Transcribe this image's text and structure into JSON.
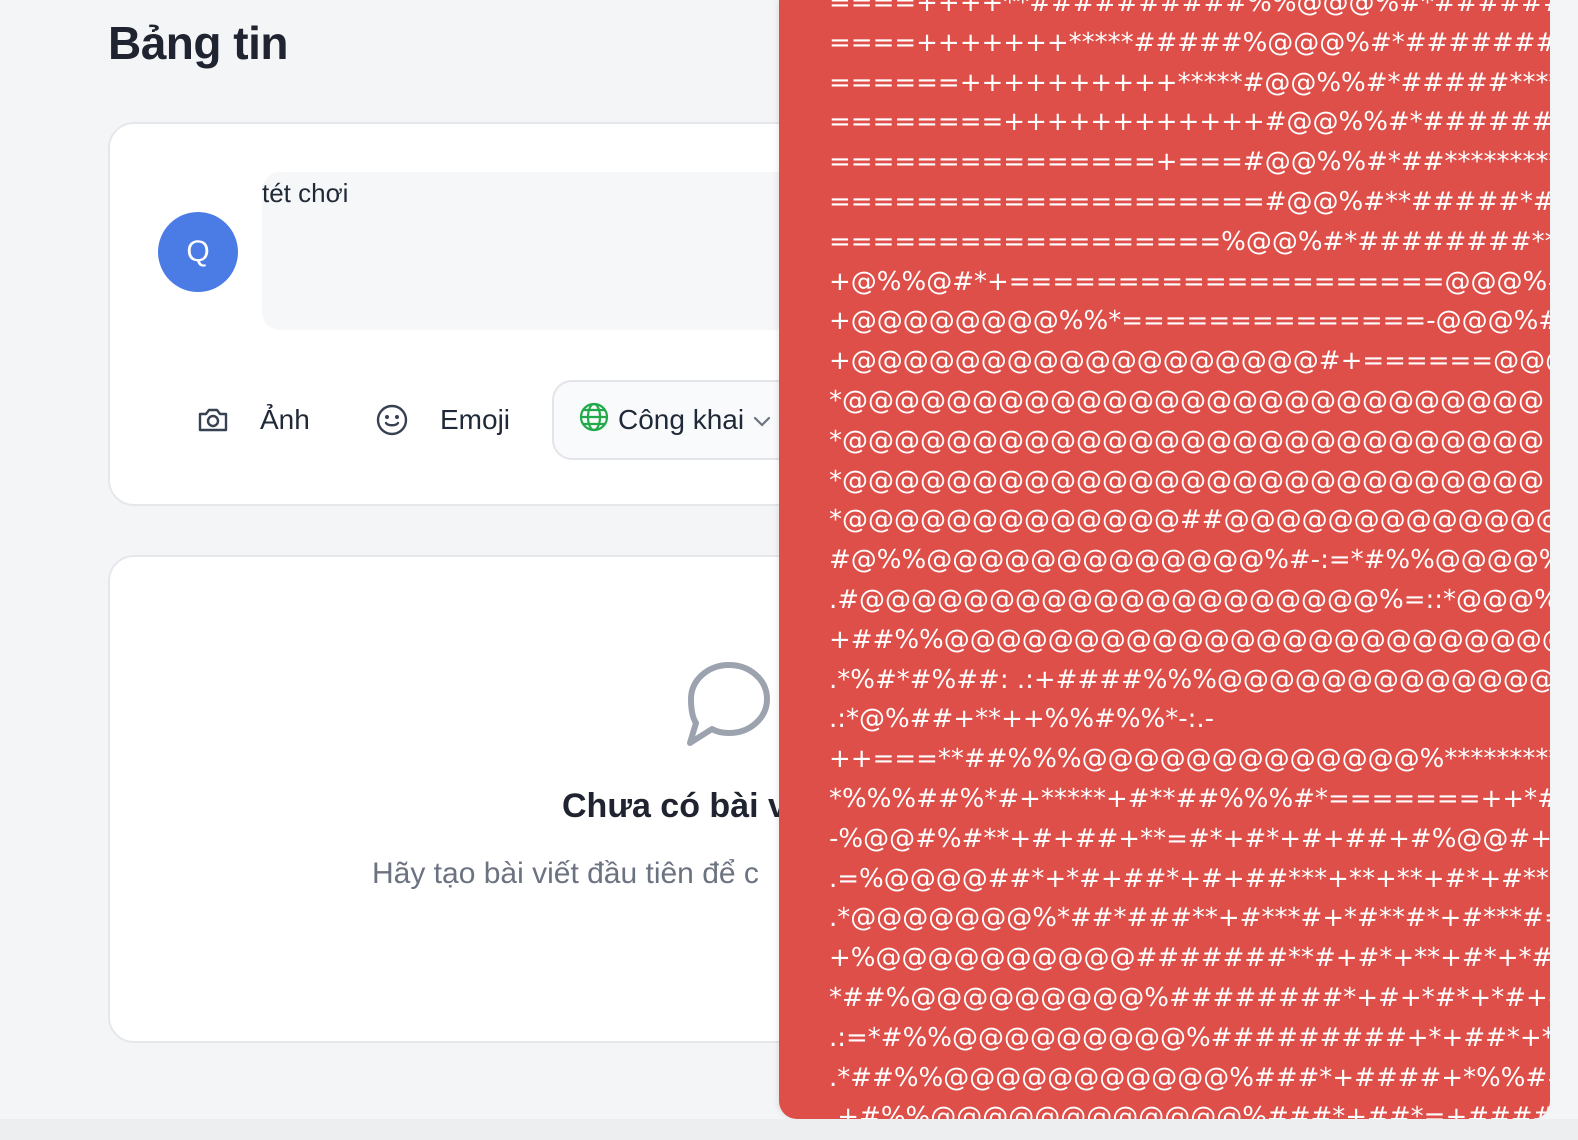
{
  "page": {
    "title": "Bảng tin"
  },
  "composer": {
    "avatar_initial": "Q",
    "text": "tét chơi",
    "photo_label": "Ảnh",
    "emoji_label": "Emoji",
    "privacy_label": "Công khai"
  },
  "feed": {
    "empty_title": "Chưa có bài v",
    "empty_subtitle": "Hãy tạo bài viết đầu tiên để c"
  },
  "ascii_art": {
    "lines": [
      "====++++**##########%%@@@%#*######*****",
      "====+++++++*****#####%@@@%#*#######*******",
      "======++++++++++*****#@@%%#*#####**********",
      "========++++++++++++#@@%%#*######********",
      "===============+===#@@%%#*##*************",
      "====================#@@%#**#####*#**********",
      "==================%@@%#*########*********",
      "+@%%@#*+====================@@@%#*#####",
      "+@@@@@@@@%%*==============-@@@%#*##",
      "+@@@@@@@@@@@@@@@@@@#+======@@@%",
      "*@@@@@@@@@@@@@@@@@@@@@@@@@@@",
      "*@@@@@@@@@@@@@@@@@@@@@@@@@@@",
      "*@@@@@@@@@@@@@@@@@@@@@@@@@@@",
      "*@@@@@@@@@@@@@##@@@@@@@@@@@@@",
      "#@%%@@@@@@@@@@@@@%#-:=*#%%@@@@%#",
      ".#@@@@@@@@@@@@@@@@@@@@%=::*@@@%",
      "+##%%@@@@@@@@@@@@@@@@@@@@@@@@",
      ".*%#*#%##: .:+####%%%@@@@@@@@@@@@@@",
      ".:*@%##+**++%%#%%*-:.-",
      "++===**##%%%@@@@@@@@@@@@@%**********",
      "*%%%##%*#+*****+#**##%%%#*=======++*##%%",
      "-%@@#%#**+#+##+**=#*+#*+#+##+#%@@#+=====",
      ".=%@@@@##*+*#+##*+#+##***+**+**+#*+#**#%%@",
      ".*@@@@@@@%*##*###**+#***#+*#**#*+#***#=*+*#",
      "+%@@@@@@@@@@#######**#+#*+**+#*+*#*+#*",
      "*##%@@@@@@@@@%########*+#+*#*+*#+#*****",
      ".:=*#%%@@@@@@@@@%#########+*+##*+**+#",
      ".*##%%@@@@@@@@@@@%###*+####+*%%####***",
      ".+#%%@@@@@@@@@@@@%###*+##*=+#####%@@@"
    ]
  }
}
